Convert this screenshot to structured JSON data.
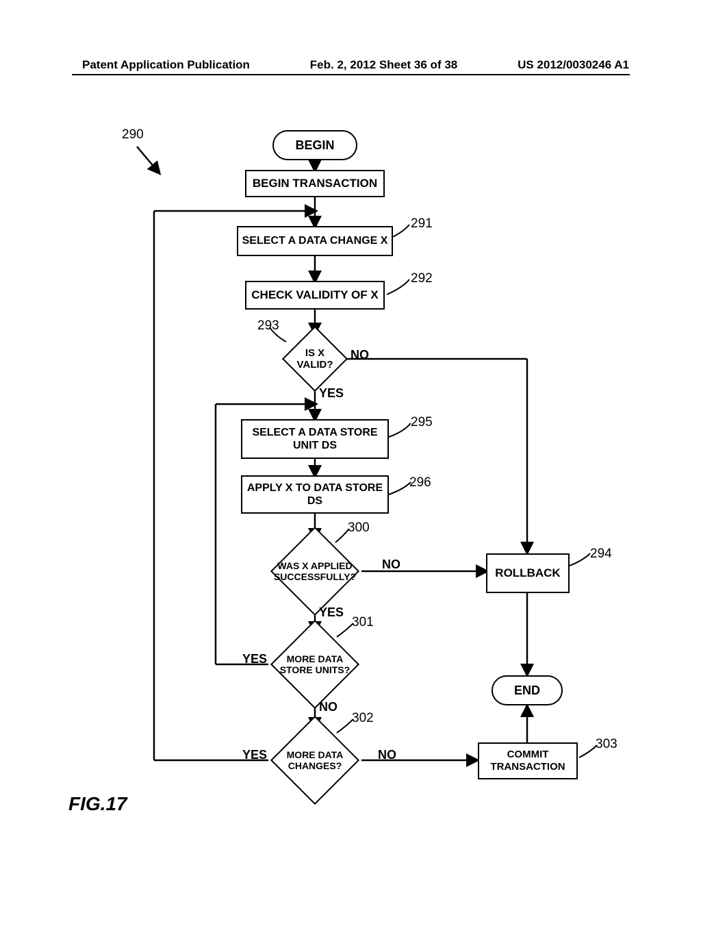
{
  "header": {
    "left": "Patent Application Publication",
    "center": "Feb. 2, 2012  Sheet 36 of 38",
    "right": "US 2012/0030246 A1"
  },
  "figure_label": "FIG.17",
  "flowchart_ref": "290",
  "nodes": {
    "begin": "BEGIN",
    "begin_tx": "BEGIN TRANSACTION",
    "select_change": "SELECT A DATA CHANGE X",
    "check_validity": "CHECK VALIDITY OF X",
    "is_valid": "IS X\nVALID?",
    "select_ds": "SELECT A DATA STORE\nUNIT DS",
    "apply": "APPLY X TO DATA STORE\nDS",
    "applied_ok": "WAS X APPLIED\nSUCCESSFULLY?",
    "more_ds": "MORE DATA\nSTORE UNITS?",
    "more_changes": "MORE DATA\nCHANGES?",
    "rollback": "ROLLBACK",
    "end": "END",
    "commit": "COMMIT\nTRANSACTION"
  },
  "refs": {
    "select_change": "291",
    "check_validity": "292",
    "is_valid": "293",
    "select_ds": "295",
    "apply": "296",
    "applied_ok": "300",
    "more_ds": "301",
    "more_changes": "302",
    "rollback": "294",
    "commit": "303"
  },
  "edge_labels": {
    "yes": "YES",
    "no": "NO"
  }
}
